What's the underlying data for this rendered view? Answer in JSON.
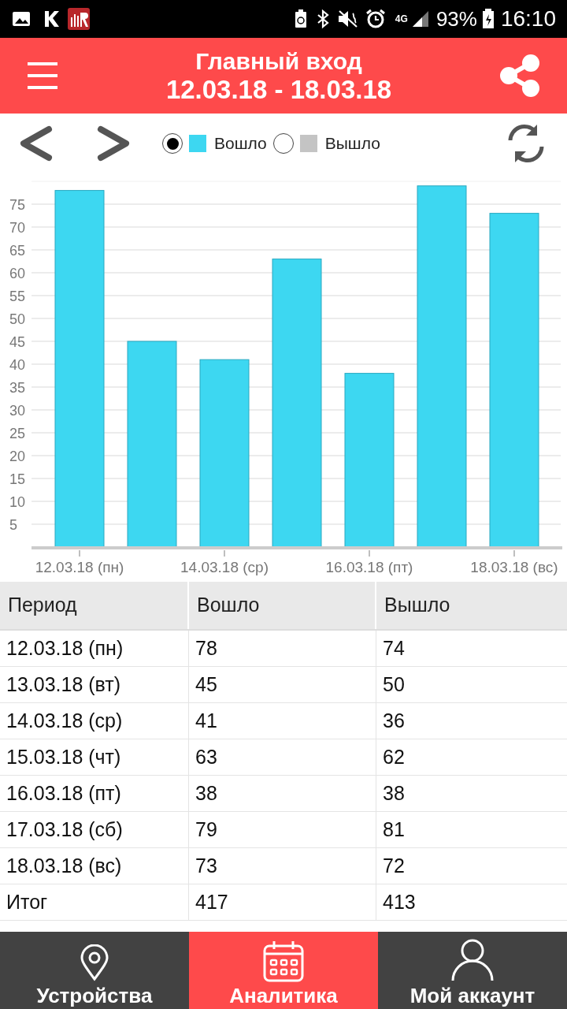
{
  "status_bar": {
    "network": "4G",
    "battery": "93%",
    "time": "16:10"
  },
  "header": {
    "title": "Главный вход",
    "subtitle": "12.03.18 - 18.03.18"
  },
  "legend": [
    {
      "label": "Вошло",
      "selected": true,
      "color": "#3dd7f1"
    },
    {
      "label": "Вышло",
      "selected": false,
      "color": "#c4c4c4"
    }
  ],
  "chart_data": {
    "type": "bar",
    "grid": true,
    "ylim": [
      0,
      80
    ],
    "yticks": [
      5,
      10,
      15,
      20,
      25,
      30,
      35,
      40,
      45,
      50,
      55,
      60,
      65,
      70,
      75
    ],
    "categories": [
      "12.03.18 (пн)",
      null,
      "14.03.18 (ср)",
      null,
      "16.03.18 (пт)",
      null,
      "18.03.18 (вс)"
    ],
    "series": [
      {
        "color": "#3dd7f1",
        "values": [
          78,
          45,
          41,
          63,
          38,
          79,
          73
        ]
      }
    ]
  },
  "table": {
    "columns": [
      "Период",
      "Вошло",
      "Вышло"
    ],
    "rows": [
      [
        "12.03.18 (пн)",
        "78",
        "74"
      ],
      [
        "13.03.18 (вт)",
        "45",
        "50"
      ],
      [
        "14.03.18 (ср)",
        "41",
        "36"
      ],
      [
        "15.03.18 (чт)",
        "63",
        "62"
      ],
      [
        "16.03.18 (пт)",
        "38",
        "38"
      ],
      [
        "17.03.18 (сб)",
        "79",
        "81"
      ],
      [
        "18.03.18 (вс)",
        "73",
        "72"
      ],
      [
        "Итог",
        "417",
        "413"
      ]
    ]
  },
  "nav": [
    {
      "label": "Устройства",
      "kind": "pin",
      "selected": false
    },
    {
      "label": "Аналитика",
      "kind": "calendar",
      "selected": true
    },
    {
      "label": "Мой аккаунт",
      "kind": "person",
      "selected": false
    }
  ]
}
